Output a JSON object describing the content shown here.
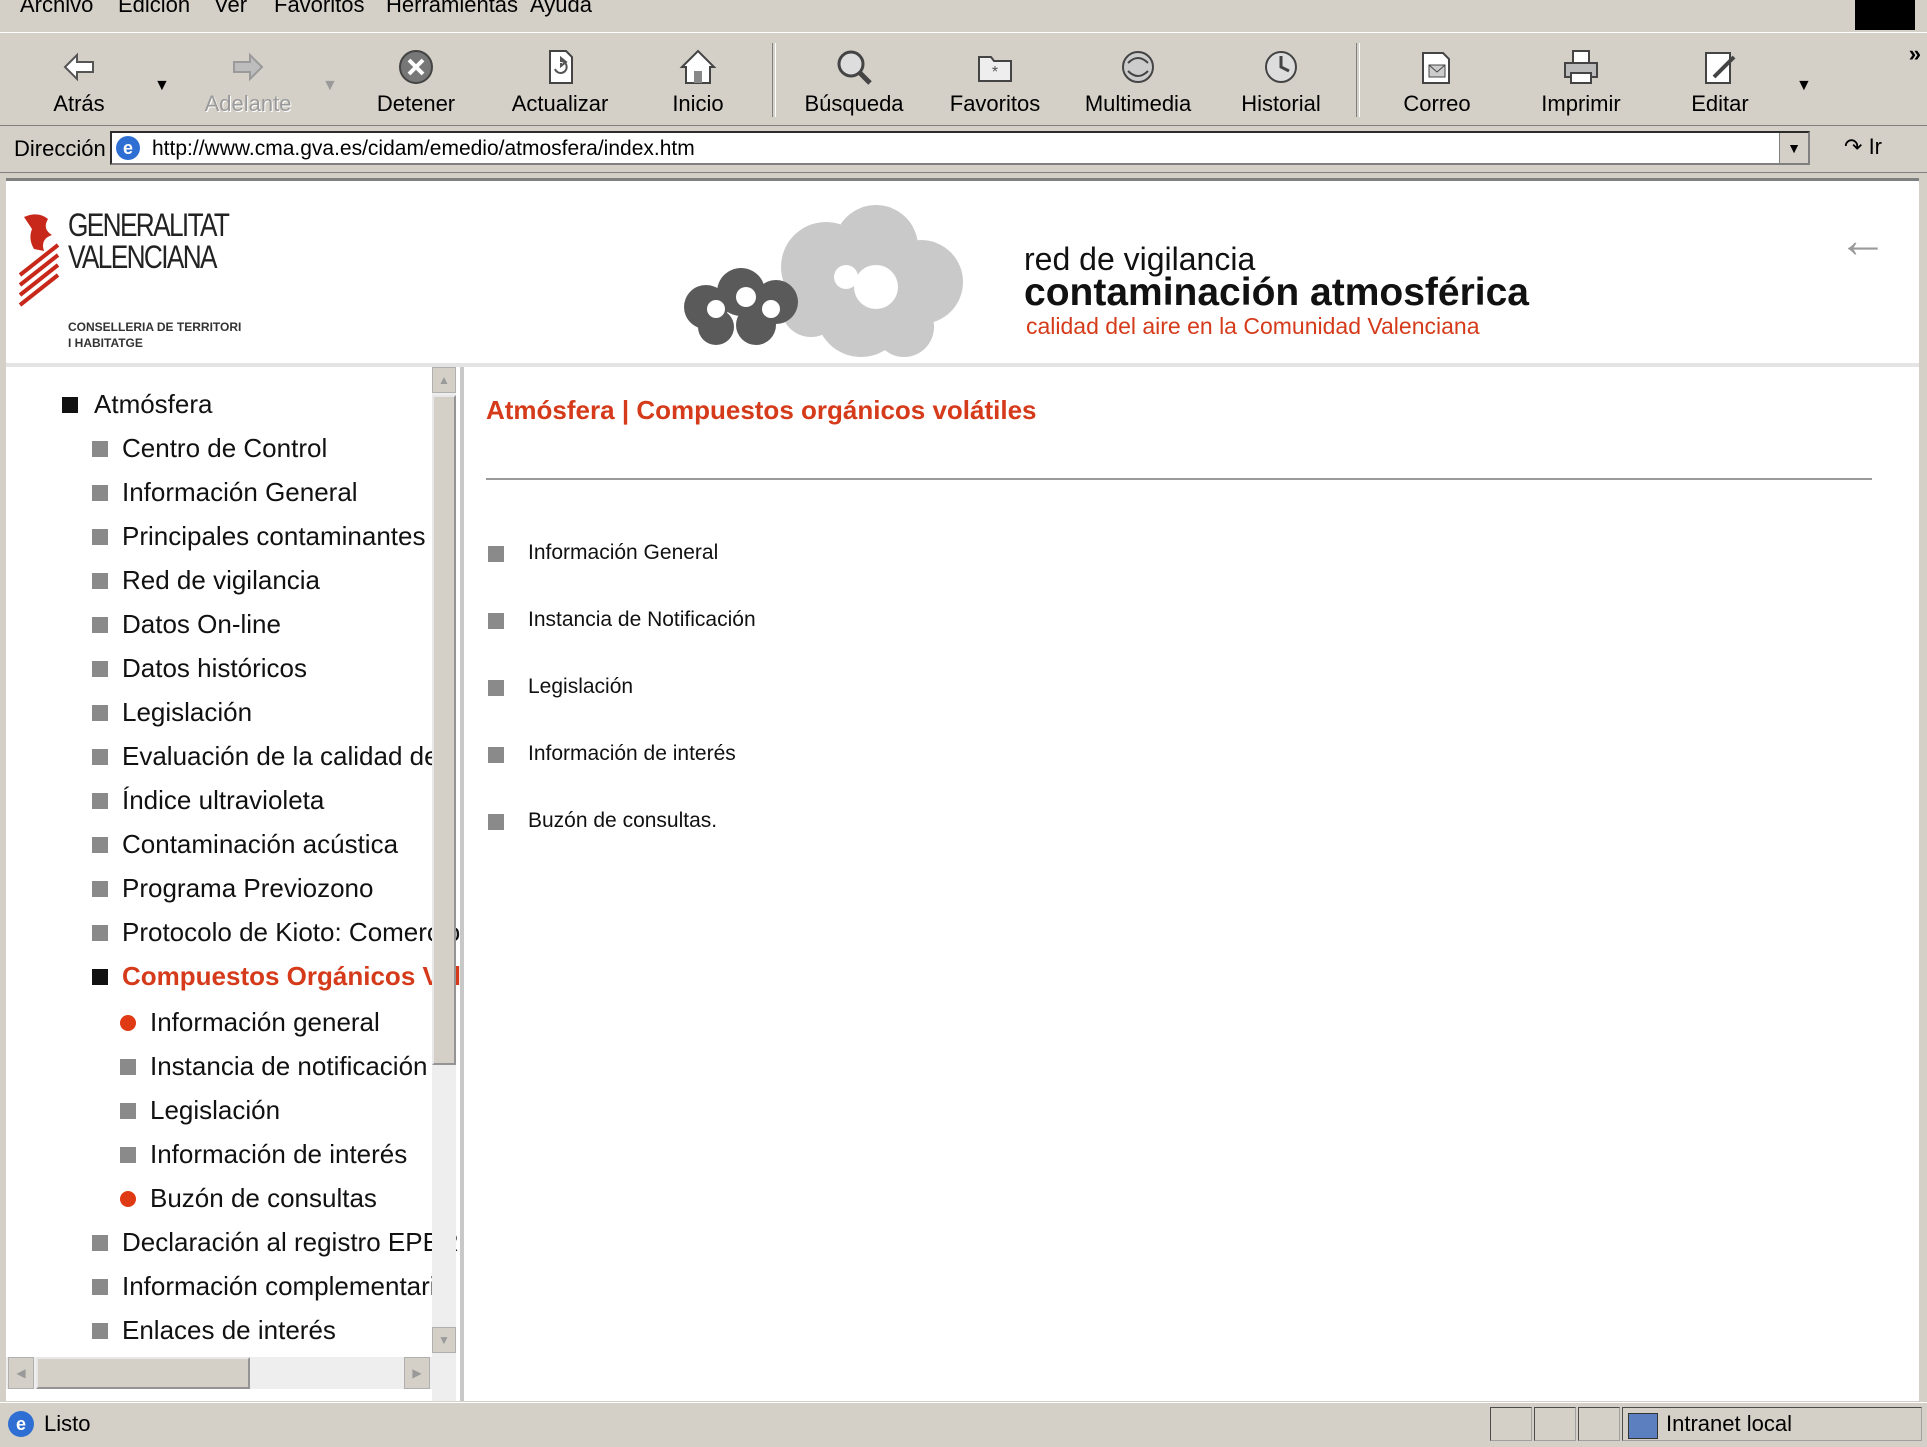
{
  "menu": [
    "Archivo",
    "Edición",
    "Ver",
    "Favoritos",
    "Herramientas",
    "Ayuda"
  ],
  "toolbar": {
    "back": "Atrás",
    "forward": "Adelante",
    "stop": "Detener",
    "refresh": "Actualizar",
    "home": "Inicio",
    "search": "Búsqueda",
    "favorites": "Favoritos",
    "media": "Multimedia",
    "history": "Historial",
    "mail": "Correo",
    "print": "Imprimir",
    "edit": "Editar"
  },
  "address": {
    "label": "Dirección",
    "url": "http://www.cma.gva.es/cidam/emedio/atmosfera/index.htm",
    "go": "Ir"
  },
  "banner": {
    "org_line1": "GENERALITAT",
    "org_line2": "VALENCIANA",
    "dept_line1": "CONSELLERIA DE TERRITORI",
    "dept_line2": "I HABITATGE",
    "line1": "red de vigilancia",
    "line2": "contaminación atmosférica",
    "line3": "calidad del aire en la Comunidad Valenciana"
  },
  "nav": {
    "root": "Atmósfera",
    "items": [
      "Centro de Control",
      "Información General",
      "Principales contaminantes",
      "Red de vigilancia",
      "Datos On-line",
      "Datos históricos",
      "Legislación",
      "Evaluación de la calidad del",
      "Índice ultravioleta",
      "Contaminación acústica",
      "Programa Previozono",
      "Protocolo de Kioto: Comercio"
    ],
    "active": "Compuestos Orgánicos Volátiles",
    "subitems": [
      "Información general",
      "Instancia de notificación",
      "Legislación",
      "Información de interés",
      "Buzón de consultas"
    ],
    "after": [
      "Declaración al registro EPER",
      "Información complementaria",
      "Enlaces de interés"
    ]
  },
  "main": {
    "title": "Atmósfera | Compuestos orgánicos volátiles",
    "links": [
      "Información General",
      "Instancia de Notificación",
      "Legislación",
      "Información de interés",
      "Buzón de consultas."
    ]
  },
  "status": {
    "text": "Listo",
    "zone": "Intranet local"
  },
  "colors": {
    "accent": "#d53b1a",
    "chrome": "#d4d0c8"
  }
}
